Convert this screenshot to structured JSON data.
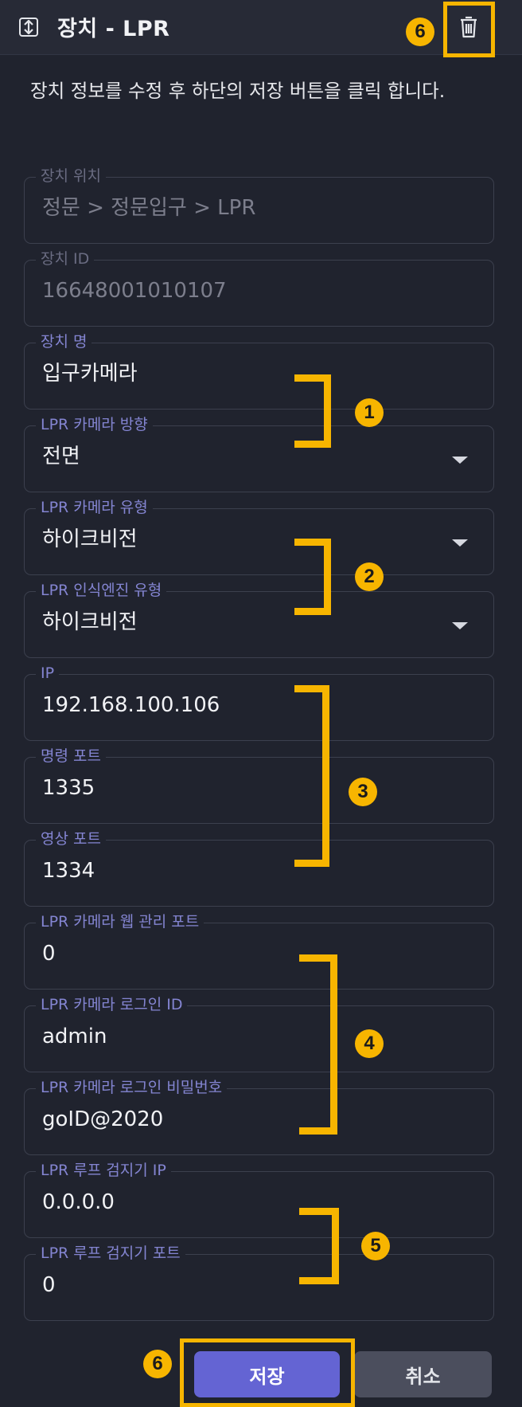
{
  "header": {
    "title": "장치 - LPR",
    "collapse_icon": "expand-collapse-icon",
    "delete_icon": "trash-icon"
  },
  "description": "장치 정보를 수정 후 하단의 저장 버튼을 클릭 합니다.",
  "fields": {
    "location": {
      "label": "장치 위치",
      "value": "정문 > 정문입구 > LPR"
    },
    "device_id": {
      "label": "장치 ID",
      "value": "16648001010107"
    },
    "device_name": {
      "label": "장치 명",
      "value": "입구카메라"
    },
    "camera_direction": {
      "label": "LPR 카메라 방향",
      "value": "전면"
    },
    "camera_type": {
      "label": "LPR 카메라 유형",
      "value": "하이크비전"
    },
    "engine_type": {
      "label": "LPR 인식엔진 유형",
      "value": "하이크비전"
    },
    "ip": {
      "label": "IP",
      "value": "192.168.100.106"
    },
    "command_port": {
      "label": "명령 포트",
      "value": "1335"
    },
    "video_port": {
      "label": "영상 포트",
      "value": "1334"
    },
    "web_port": {
      "label": "LPR 카메라 웹 관리 포트",
      "value": "0"
    },
    "login_id": {
      "label": "LPR 카메라 로그인 ID",
      "value": "admin"
    },
    "login_password": {
      "label": "LPR 카메라 로그인 비밀번호",
      "value": "goID@2020"
    },
    "loop_ip": {
      "label": "LPR 루프 검지기 IP",
      "value": "0.0.0.0"
    },
    "loop_port": {
      "label": "LPR 루프 검지기 포트",
      "value": "0"
    }
  },
  "buttons": {
    "save": "저장",
    "cancel": "취소"
  },
  "annotations": {
    "badge_1": "1",
    "badge_2": "2",
    "badge_3": "3",
    "badge_4": "4",
    "badge_5": "5",
    "badge_6": "6",
    "highlight_color": "#f7b500"
  },
  "colors": {
    "background": "#20232e",
    "accent": "#6464d3",
    "label": "#8485d2"
  }
}
